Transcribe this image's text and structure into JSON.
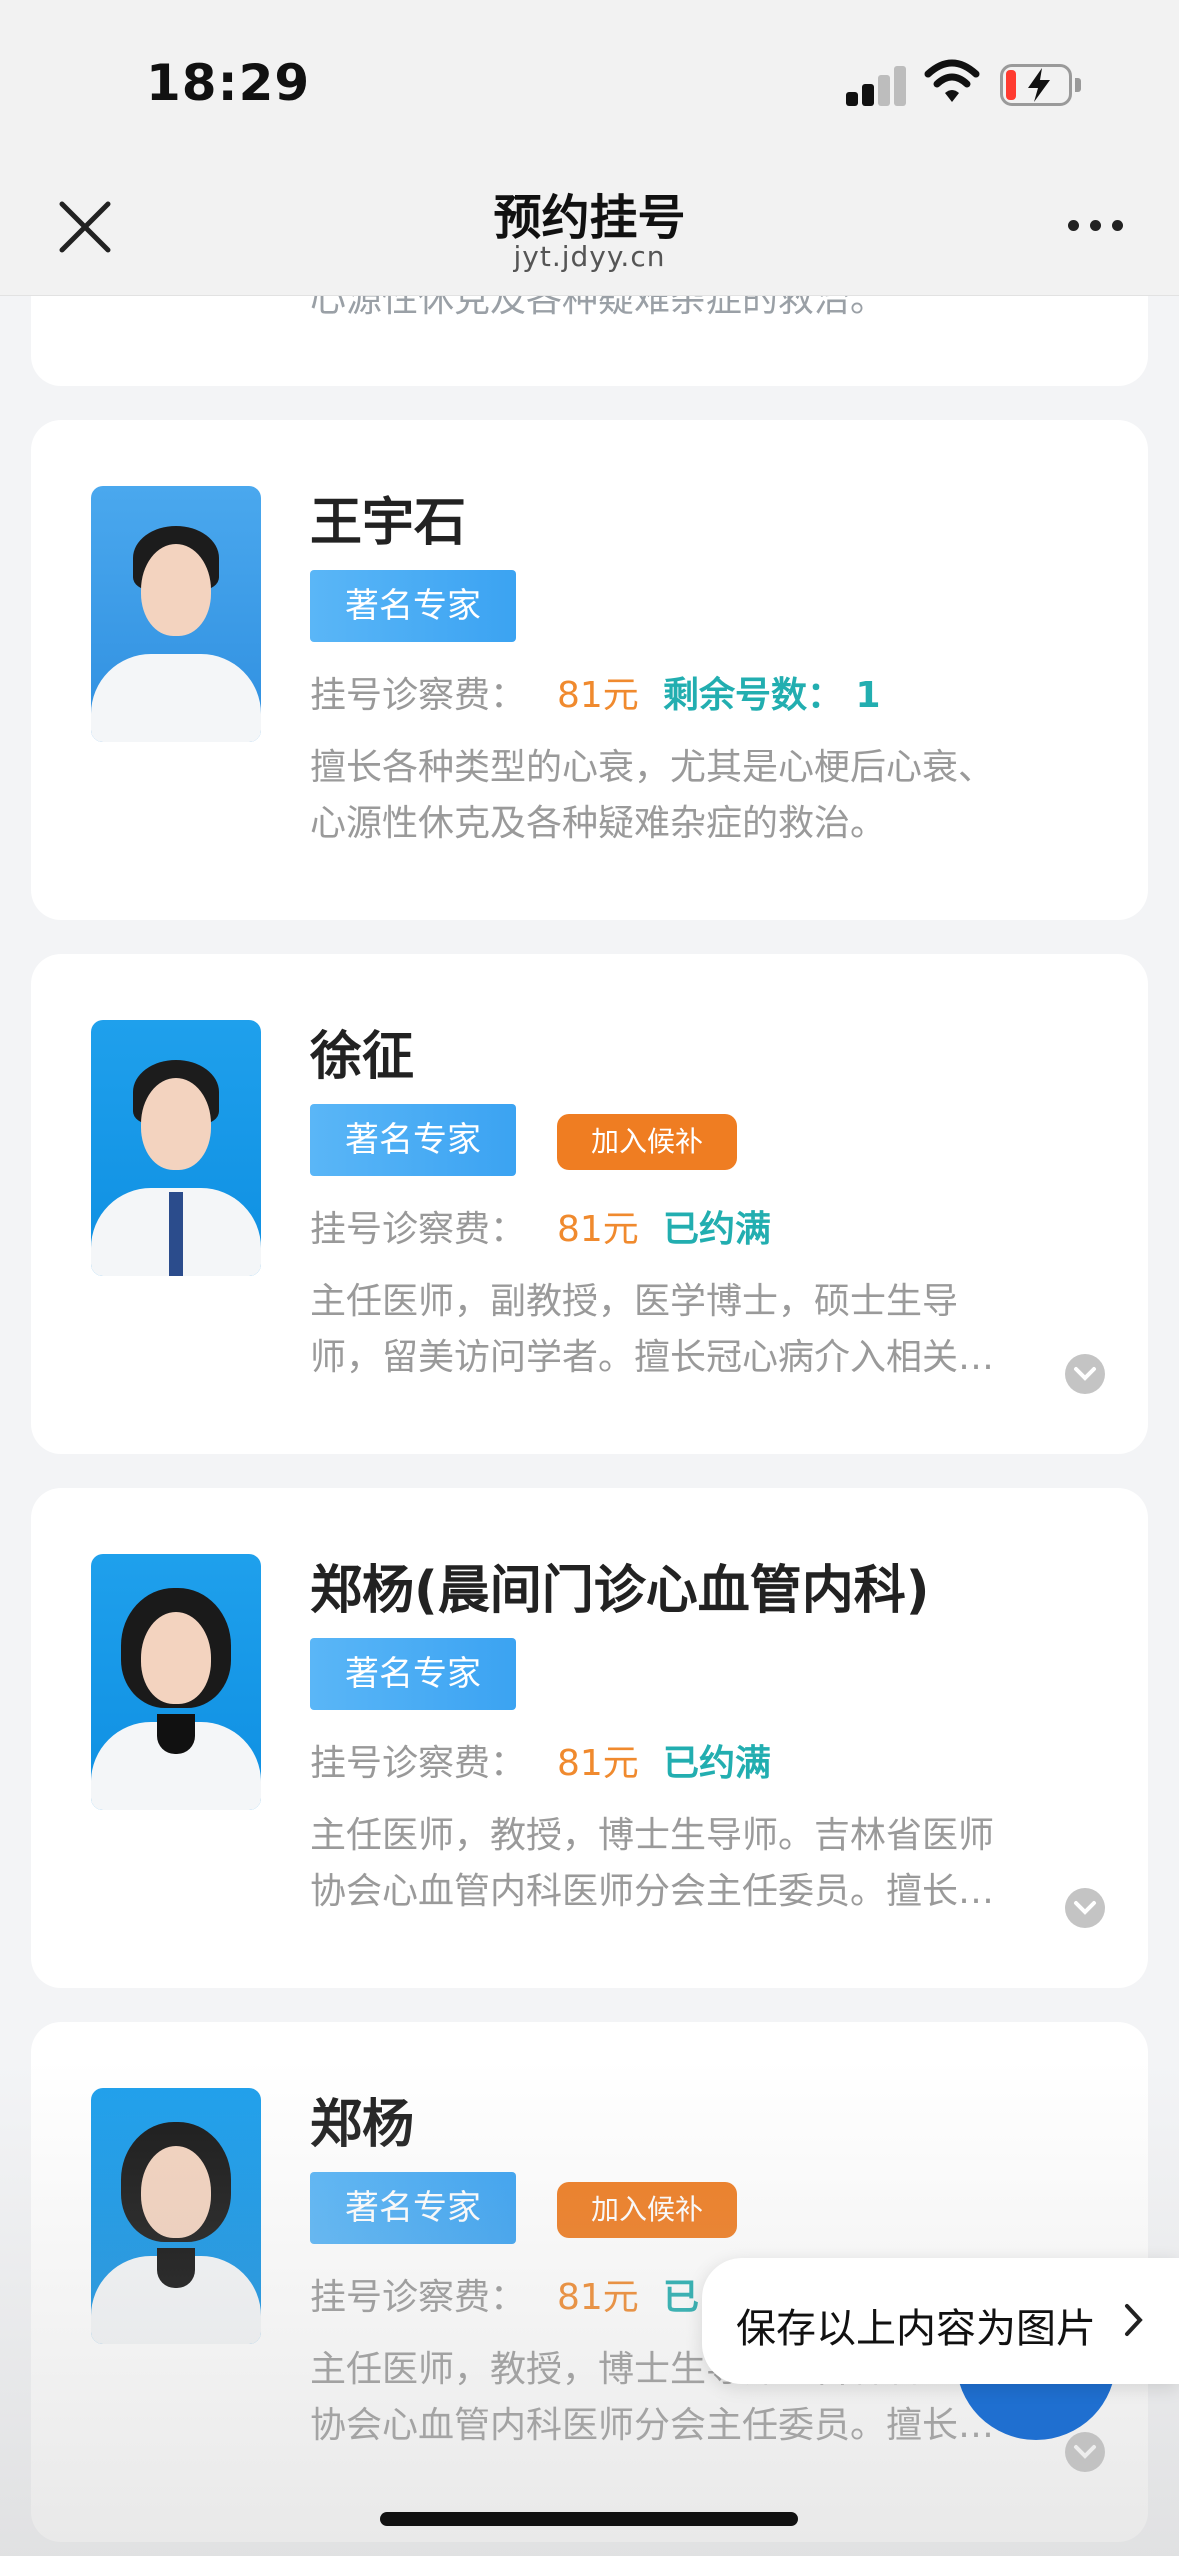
{
  "status": {
    "time": "18:29"
  },
  "nav": {
    "title": "预约挂号",
    "subtitle": "jyt.jdyy.cn"
  },
  "previous_card": {
    "text": "心源性休克及各种疑难杂症的救治。"
  },
  "doctors": [
    {
      "name": "王宇石",
      "badge": "著名专家",
      "fee_label": "挂号诊察费：",
      "fee": "81元",
      "status": "剩余号数： 1",
      "waitlist": "",
      "desc": [
        "擅长各种类型的心衰，尤其是心梗后心衰、",
        "心源性休克及各种疑难杂症的救治。"
      ]
    },
    {
      "name": "徐征",
      "badge": "著名专家",
      "fee_label": "挂号诊察费：",
      "fee": "81元",
      "status": "已约满",
      "waitlist": "加入候补",
      "desc": [
        "主任医师，副教授，医学博士，硕士生导",
        "师，留美访问学者。擅长冠心病介入相关…"
      ]
    },
    {
      "name": "郑杨(晨间门诊心血管内科)",
      "badge": "著名专家",
      "fee_label": "挂号诊察费：",
      "fee": "81元",
      "status": "已约满",
      "waitlist": "",
      "desc": [
        "主任医师，教授，博士生导师。吉林省医师",
        "协会心血管内科医师分会主任委员。擅长…"
      ]
    },
    {
      "name": "郑杨",
      "badge": "著名专家",
      "fee_label": "挂号诊察费：",
      "fee": "81元",
      "status": "已",
      "waitlist": "加入候补",
      "desc": [
        "主任医师，教授，博士生导师。吉林省",
        "协会心血管内科医师分会主任委员。擅长…"
      ]
    }
  ],
  "toast": {
    "text": "保存以上内容为图片"
  },
  "colors": {
    "fee": "#f08a2e",
    "status": "#22aeb0",
    "badge": "#3ba3f2",
    "waitlist": "#ef7d22"
  }
}
